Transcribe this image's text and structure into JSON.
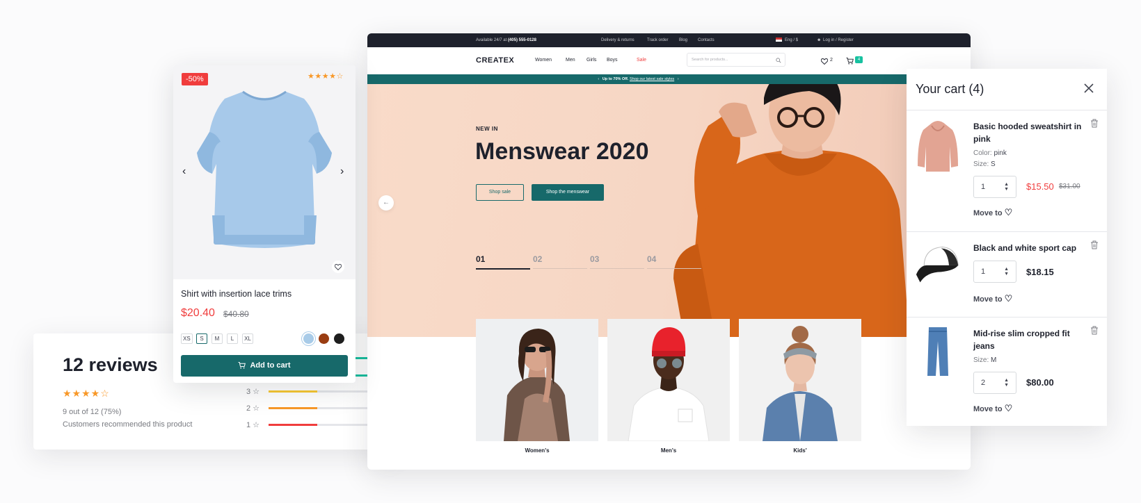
{
  "reviews": {
    "title": "12 reviews",
    "stars": "★★★★☆",
    "rating": 4,
    "recommend_line": "9 out of 12 (75%)",
    "recommend_text": "Customers recommended this product",
    "rows": [
      {
        "label": "3 ☆",
        "fraction": 0.44,
        "color": "#f8c732"
      },
      {
        "label": "2 ☆",
        "fraction": 0.44,
        "color": "#f89828"
      },
      {
        "label": "1 ☆",
        "fraction": 0.44,
        "color": "#f03d3d"
      }
    ]
  },
  "site": {
    "topbar": {
      "support": "Available 24/7 at",
      "phone": "(405) 555-0128",
      "links": [
        "Delivery & returns",
        "Track order",
        "Blog",
        "Contacts"
      ],
      "lang": "Eng / $",
      "login": "Log in / Register"
    },
    "logo": "CREATEX",
    "nav": [
      "Women",
      "Men",
      "Girls",
      "Boys",
      "Sale"
    ],
    "sale_color": "#f03d3d",
    "search_placeholder": "Search for products...",
    "wishlist_count": "2",
    "cart_count": "4",
    "promo": {
      "text": "Up to 70% Off.",
      "link": "Shop our latest sale styles"
    },
    "hero": {
      "kicker": "NEW IN",
      "title": "Menswear 2020",
      "btn_sale": "Shop sale",
      "btn_menswear": "Shop the menswear",
      "slides": [
        "01",
        "02",
        "03",
        "04"
      ],
      "active_slide": 0
    },
    "categories": [
      "Women's",
      "Men's",
      "Kids'"
    ]
  },
  "product": {
    "badge": "-50%",
    "stars": "★★★★☆",
    "rating": 4,
    "name": "Shirt with insertion lace trims",
    "price": "$20.40",
    "old_price": "$40.80",
    "sizes": [
      "XS",
      "S",
      "M",
      "L",
      "XL"
    ],
    "selected_size": "S",
    "colors": [
      "#a8cbe8",
      "#9a3d12",
      "#1e1e1e"
    ],
    "add_to_cart": "Add to cart"
  },
  "cart": {
    "title": "Your cart (4)",
    "items": [
      {
        "name": "Basic hooded sweatshirt in pink",
        "color_label": "Color:",
        "color": "pink",
        "size_label": "Size:",
        "size": "S",
        "qty": "1",
        "price": "$15.50",
        "old_price": "$31.00",
        "move_to": "Move to"
      },
      {
        "name": "Black and white sport cap",
        "qty": "1",
        "price": "$18.15",
        "move_to": "Move to"
      },
      {
        "name": "Mid-rise slim cropped fit jeans",
        "size_label": "Size:",
        "size": "M",
        "qty": "2",
        "price": "$80.00",
        "move_to": "Move to"
      }
    ]
  },
  "colors": {
    "primary": "#17696a",
    "danger": "#f03d3d",
    "star": "#f89828",
    "dark": "#1e212c"
  }
}
